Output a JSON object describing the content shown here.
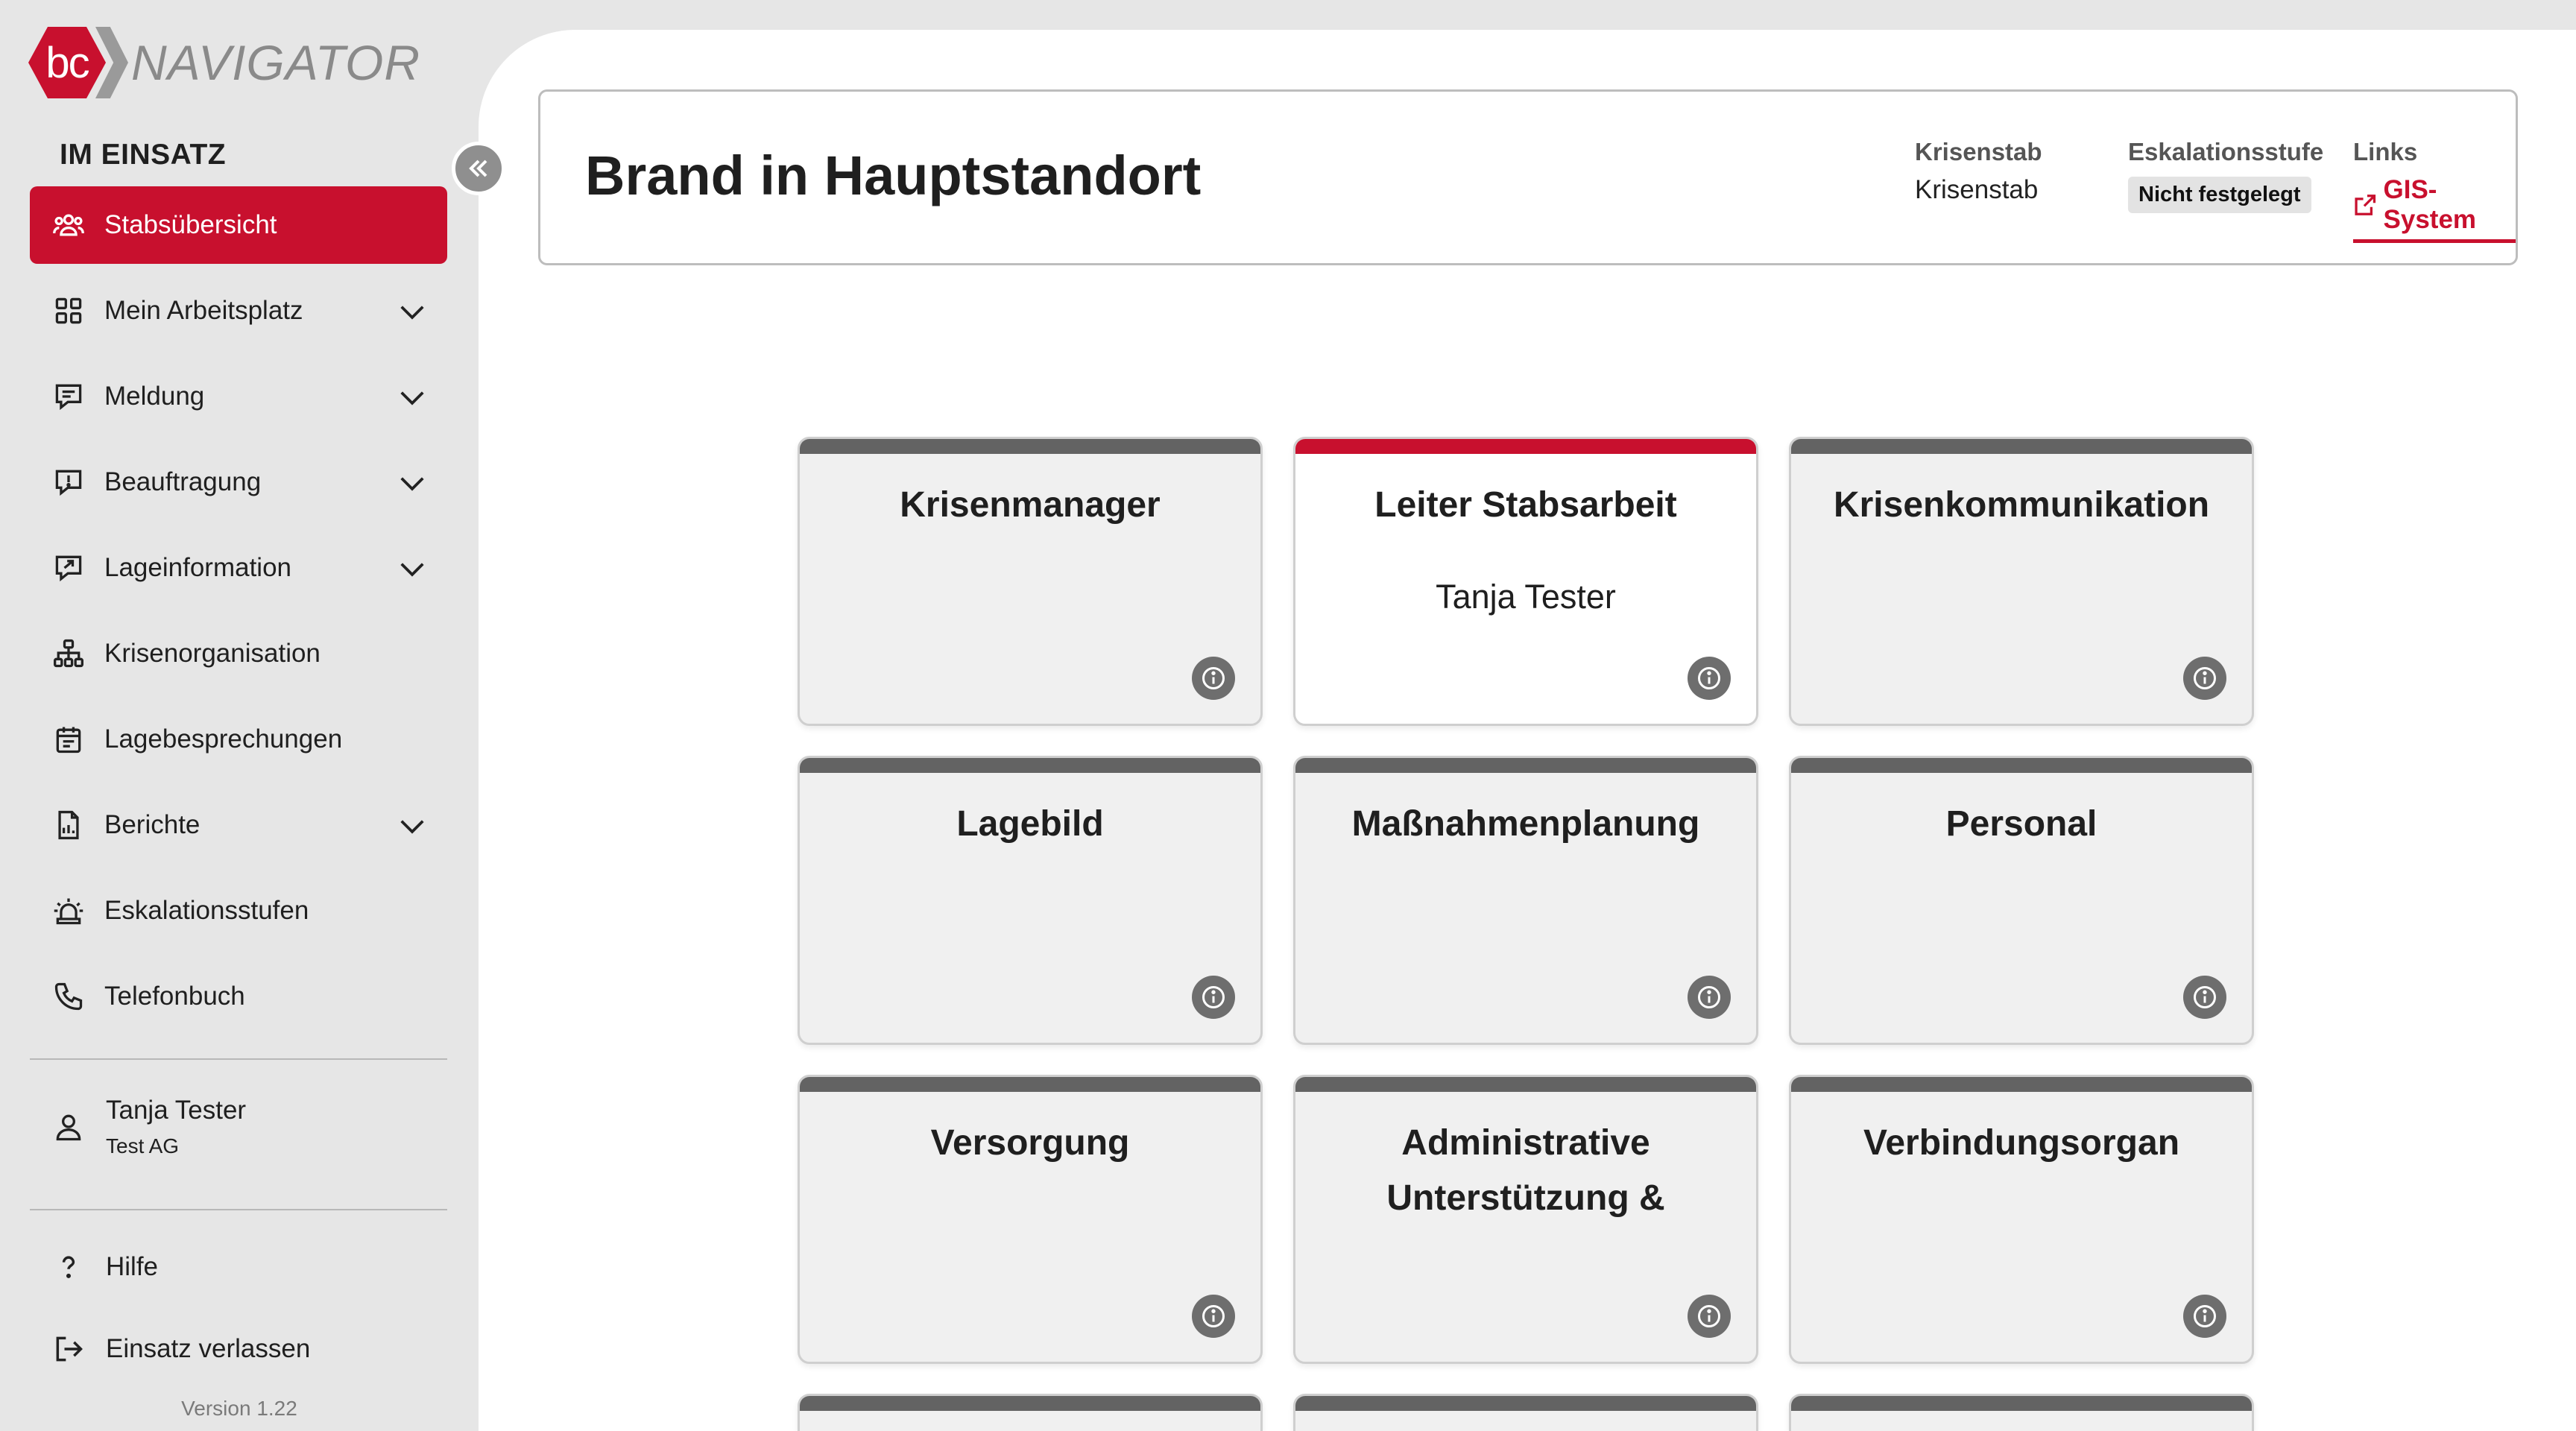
{
  "app": {
    "logo_mark": "bc",
    "logo_text": "NAVIGATOR",
    "brand_color": "#c8102e"
  },
  "sidebar": {
    "section_title": "IM EINSATZ",
    "items": [
      {
        "label": "Stabsübersicht",
        "icon": "people-icon",
        "active": true,
        "expandable": false
      },
      {
        "label": "Mein Arbeitsplatz",
        "icon": "grid-icon",
        "active": false,
        "expandable": true
      },
      {
        "label": "Meldung",
        "icon": "message-icon",
        "active": false,
        "expandable": true
      },
      {
        "label": "Beauftragung",
        "icon": "alert-message-icon",
        "active": false,
        "expandable": true
      },
      {
        "label": "Lageinformation",
        "icon": "arrow-message-icon",
        "active": false,
        "expandable": true
      },
      {
        "label": "Krisenorganisation",
        "icon": "org-chart-icon",
        "active": false,
        "expandable": false
      },
      {
        "label": "Lagebesprechungen",
        "icon": "calendar-icon",
        "active": false,
        "expandable": false
      },
      {
        "label": "Berichte",
        "icon": "document-icon",
        "active": false,
        "expandable": true
      },
      {
        "label": "Eskalationsstufen",
        "icon": "siren-icon",
        "active": false,
        "expandable": false
      },
      {
        "label": "Telefonbuch",
        "icon": "phone-icon",
        "active": false,
        "expandable": false
      }
    ],
    "user": {
      "name": "Tanja Tester",
      "org": "Test AG"
    },
    "help_label": "Hilfe",
    "leave_label": "Einsatz verlassen",
    "version": "Version 1.22"
  },
  "header": {
    "title": "Brand in Hauptstandort",
    "krisenstab_label": "Krisenstab",
    "krisenstab_value": "Krisenstab",
    "eskalation_label": "Eskalationsstufe",
    "eskalation_value": "Nicht festgelegt",
    "links_label": "Links",
    "gis_link": "GIS-System"
  },
  "cards": [
    {
      "title": "Krisenmanager",
      "person": "",
      "active": false
    },
    {
      "title": "Leiter Stabsarbeit",
      "person": "Tanja Tester",
      "active": true
    },
    {
      "title": "Krisenkommunikation",
      "person": "",
      "active": false
    },
    {
      "title": "Lagebild",
      "person": "",
      "active": false
    },
    {
      "title": "Maßnahmenplanung",
      "person": "",
      "active": false
    },
    {
      "title": "Personal",
      "person": "",
      "active": false
    },
    {
      "title": "Versorgung",
      "person": "",
      "active": false
    },
    {
      "title": "Administrative Unterstützung &",
      "person": "",
      "active": false
    },
    {
      "title": "Verbindungsorgan",
      "person": "",
      "active": false
    }
  ]
}
